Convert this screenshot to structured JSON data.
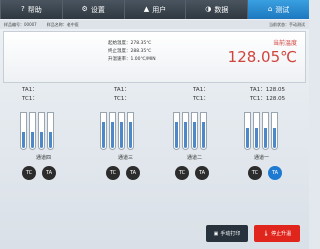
{
  "nav": {
    "tabs": [
      {
        "label": "测试",
        "icon": "home-icon",
        "active": true
      },
      {
        "label": "数据",
        "icon": "circle-icon",
        "active": false
      },
      {
        "label": "用户",
        "icon": "user-icon",
        "active": false
      },
      {
        "label": "设置",
        "icon": "gear-icon",
        "active": false
      },
      {
        "label": "帮助",
        "icon": "question-icon",
        "active": false
      }
    ]
  },
  "info": {
    "breadcrumb": "当前状态：手动测试",
    "sample_name": "样品名称：老中医",
    "sample_no": "样品编号：00007"
  },
  "main": {
    "label": "当前温度",
    "value": "128.05℃",
    "params": [
      "起始温度：278.35℃",
      "终止温度：288.35℃",
      "升温速率：1.00℃/MIN"
    ]
  },
  "channels": [
    {
      "name": "通道一",
      "ta1": "TA1：128.05",
      "tc1": "TC1：128.05",
      "fills": [
        0.55,
        0.55,
        0.55,
        0.55
      ],
      "ta_active": true
    },
    {
      "name": "通道二",
      "ta1": "TA1：",
      "tc1": "TC1：",
      "fills": [
        0.72,
        0.72,
        0.72,
        0.72
      ],
      "ta_active": false
    },
    {
      "name": "通道三",
      "ta1": "TA1：",
      "tc1": "TC1：",
      "fills": [
        0.72,
        0.72,
        0.72,
        0.72
      ],
      "ta_active": false
    },
    {
      "name": "通道四",
      "ta1": "TA1：",
      "tc1": "TC1：",
      "fills": [
        0.45,
        0.45,
        0.45,
        0.45
      ],
      "ta_active": false
    }
  ],
  "circle_labels": {
    "ta": "TA",
    "tc": "TC"
  },
  "buttons": {
    "stop": "停止升温",
    "print": "手动打印"
  }
}
